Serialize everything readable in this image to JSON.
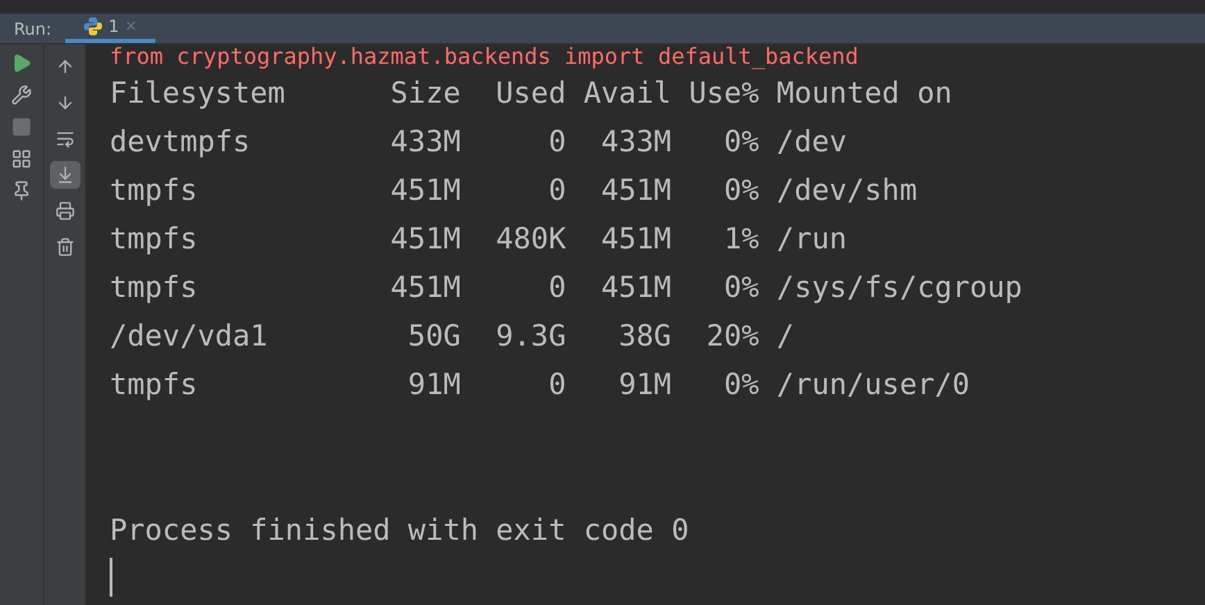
{
  "run_panel": {
    "label": "Run:",
    "tabs": [
      {
        "title": "1",
        "close": "×",
        "selected": true
      }
    ]
  },
  "left_toolbar": [
    {
      "kind": "run",
      "disabled": false
    },
    {
      "kind": "wrench",
      "disabled": false
    },
    {
      "kind": "stop",
      "disabled": true
    },
    {
      "kind": "layout",
      "disabled": false
    },
    {
      "kind": "pin",
      "disabled": false
    }
  ],
  "console_toolbar": [
    {
      "kind": "up",
      "selected": false
    },
    {
      "kind": "down",
      "selected": false
    },
    {
      "kind": "wrap",
      "selected": false
    },
    {
      "kind": "scroll_end",
      "selected": true
    },
    {
      "kind": "print",
      "selected": false
    },
    {
      "kind": "trash",
      "selected": false
    }
  ],
  "console": [
    {
      "kind": "error",
      "text": "from cryptography.hazmat.backends import default_backend"
    },
    {
      "kind": "output",
      "text": "Filesystem      Size  Used Avail Use% Mounted on"
    },
    {
      "kind": "output",
      "text": "devtmpfs        433M     0  433M   0% /dev"
    },
    {
      "kind": "output",
      "text": "tmpfs           451M     0  451M   0% /dev/shm"
    },
    {
      "kind": "output",
      "text": "tmpfs           451M  480K  451M   1% /run"
    },
    {
      "kind": "output",
      "text": "tmpfs           451M     0  451M   0% /sys/fs/cgroup"
    },
    {
      "kind": "output",
      "text": "/dev/vda1        50G  9.3G   38G  20% /"
    },
    {
      "kind": "output",
      "text": "tmpfs            91M     0   91M   0% /run/user/0"
    },
    {
      "kind": "blank"
    },
    {
      "kind": "blank"
    },
    {
      "kind": "output",
      "text": "Process finished with exit code 0"
    }
  ],
  "cursor": true
}
